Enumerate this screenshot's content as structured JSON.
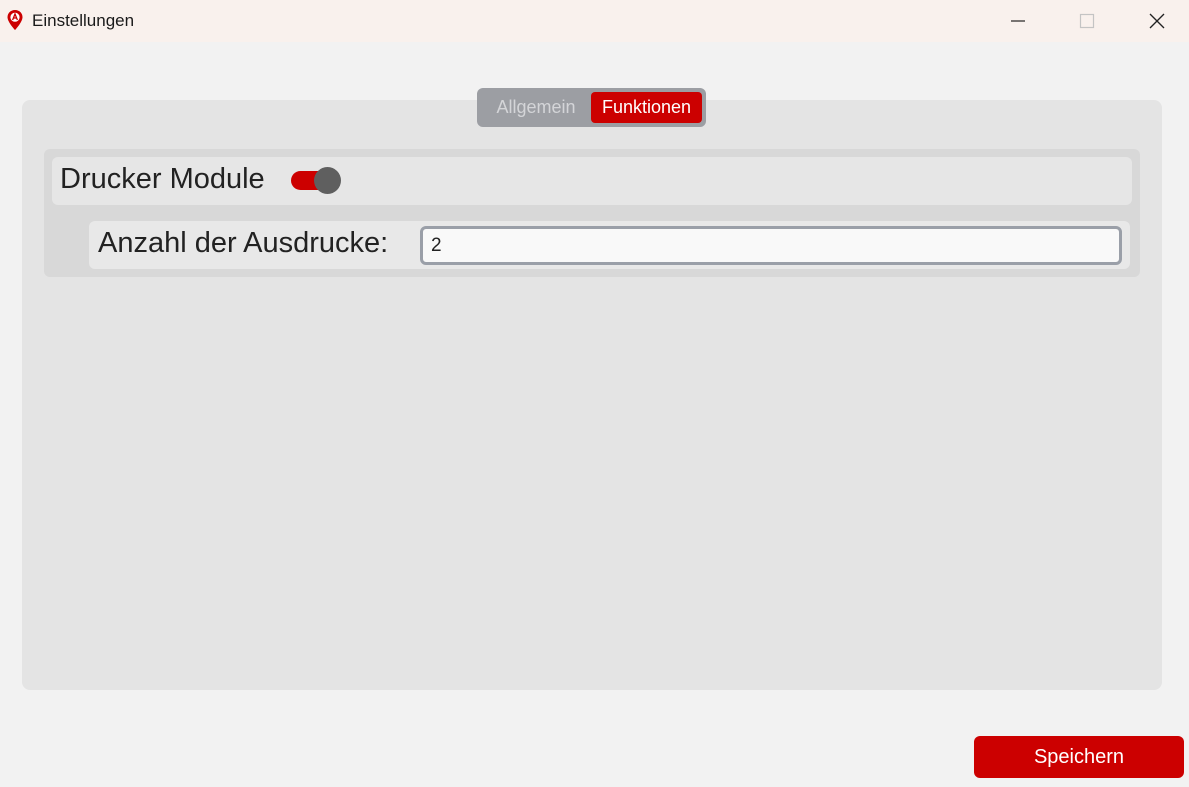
{
  "window": {
    "title": "Einstellungen",
    "icon": "map-pin-icon",
    "controls": [
      "minimize-icon",
      "maximize-icon",
      "close-icon"
    ]
  },
  "tabs": [
    {
      "label": "Allgemein",
      "selected": false
    },
    {
      "label": "Funktionen",
      "selected": true
    }
  ],
  "printer_module": {
    "label": "Drucker Module",
    "enabled": true,
    "count_label": "Anzahl der Ausdrucke:",
    "count_value": "2"
  },
  "footer": {
    "save_label": "Speichern"
  },
  "colors": {
    "accent": "#cc0000",
    "panel": "#e4e4e4",
    "background": "#f2f2f2"
  }
}
